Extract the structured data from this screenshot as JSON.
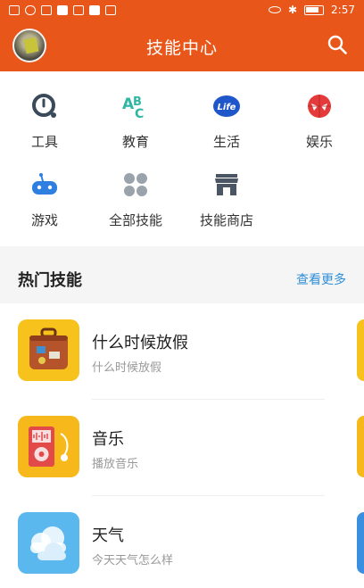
{
  "status_bar": {
    "time": "2:57"
  },
  "header": {
    "title": "技能中心"
  },
  "categories": [
    {
      "label": "工具",
      "icon": "tool-clock-icon",
      "color": "#3b4a5a"
    },
    {
      "label": "教育",
      "icon": "abc-education-icon",
      "color": "#2fb7a4"
    },
    {
      "label": "生活",
      "icon": "life-icon",
      "color": "#1f56c9"
    },
    {
      "label": "娱乐",
      "icon": "spiderman-mask-icon",
      "color": "#e53a3a"
    },
    {
      "label": "游戏",
      "icon": "gamepad-robot-icon",
      "color": "#2f7fe0"
    },
    {
      "label": "全部技能",
      "icon": "four-dots-icon",
      "color": "#9aa3ab"
    },
    {
      "label": "技能商店",
      "icon": "store-icon",
      "color": "#4b5563"
    }
  ],
  "hot_section": {
    "title": "热门技能",
    "more_label": "查看更多"
  },
  "skills": [
    {
      "name": "什么时候放假",
      "desc": "什么时候放假",
      "icon": "suitcase-icon",
      "bg": "#f7c21b"
    },
    {
      "name": "音乐",
      "desc": "播放音乐",
      "icon": "music-player-icon",
      "bg": "#f7b81b"
    },
    {
      "name": "天气",
      "desc": "今天天气怎么样",
      "icon": "cloud-icon",
      "bg": "#5ab8ee"
    }
  ]
}
